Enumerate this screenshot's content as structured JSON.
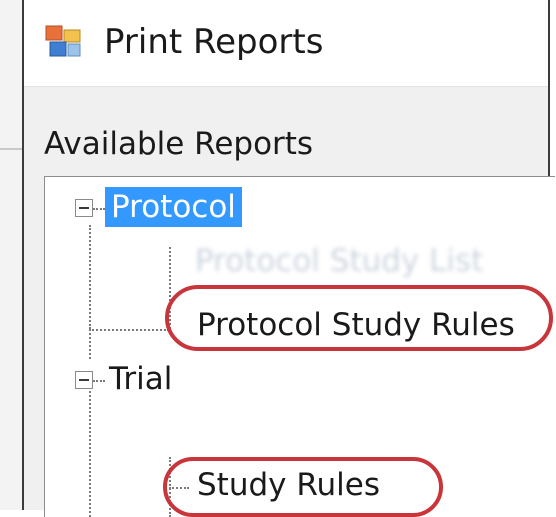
{
  "window": {
    "title": "Print Reports",
    "icon": "print-reports-app-icon"
  },
  "available_reports": {
    "label": "Available Reports",
    "tree": [
      {
        "label": "Protocol",
        "expanded": true,
        "selected": true,
        "children": [
          {
            "label": "Protocol Study List",
            "obscured": true
          },
          {
            "label": "Protocol Study Rules",
            "highlighted": true
          }
        ]
      },
      {
        "label": "Trial",
        "expanded": true,
        "selected": false,
        "children": [
          {
            "label": "Study Rules",
            "highlighted": true
          }
        ]
      }
    ]
  },
  "colors": {
    "selection": "#3399ff",
    "highlight_ring": "#c8353b",
    "dialog_bg": "#f0f0f0"
  }
}
